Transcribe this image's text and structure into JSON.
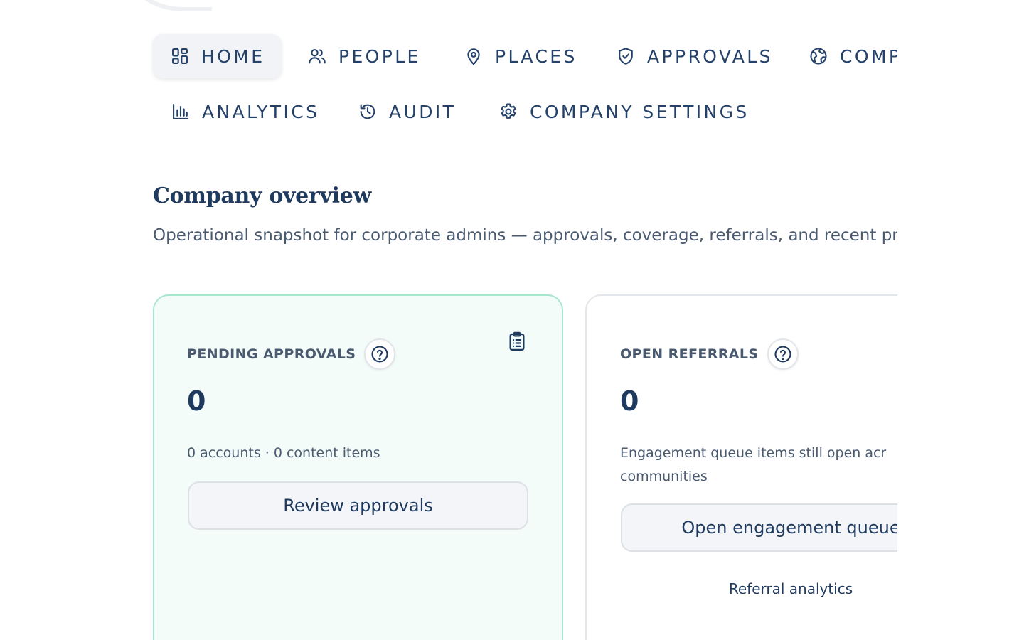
{
  "nav": {
    "row1": [
      {
        "label": "HOME",
        "icon": "dashboard-icon",
        "active": true
      },
      {
        "label": "PEOPLE",
        "icon": "users-icon"
      },
      {
        "label": "PLACES",
        "icon": "map-pin-icon"
      },
      {
        "label": "APPROVALS",
        "icon": "shield-check-icon"
      },
      {
        "label": "COMP",
        "icon": "globe-icon"
      }
    ],
    "row2": [
      {
        "label": "ANALYTICS",
        "icon": "bar-chart-icon"
      },
      {
        "label": "AUDIT",
        "icon": "history-icon"
      },
      {
        "label": "COMPANY SETTINGS",
        "icon": "gear-icon"
      }
    ]
  },
  "header": {
    "title": "Company overview",
    "subtitle": "Operational snapshot for corporate admins — approvals, coverage, referrals, and recent pri"
  },
  "cards": {
    "pending": {
      "label": "PENDING APPROVALS",
      "value": "0",
      "description": "0 accounts · 0 content items",
      "button": "Review approvals",
      "icon": "clipboard-icon"
    },
    "referrals": {
      "label": "OPEN REFERRALS",
      "value": "0",
      "description_line1": "Engagement queue items still open acr",
      "description_line2": "communities",
      "button": "Open engagement queue",
      "link": "Referral analytics"
    }
  },
  "colors": {
    "text_primary": "#1f3a5f",
    "text_secondary": "#4a5a70",
    "pending_card_bg": "#f3fcf8",
    "pending_card_border": "#a6e6cd",
    "button_bg": "#f3f5f8"
  }
}
